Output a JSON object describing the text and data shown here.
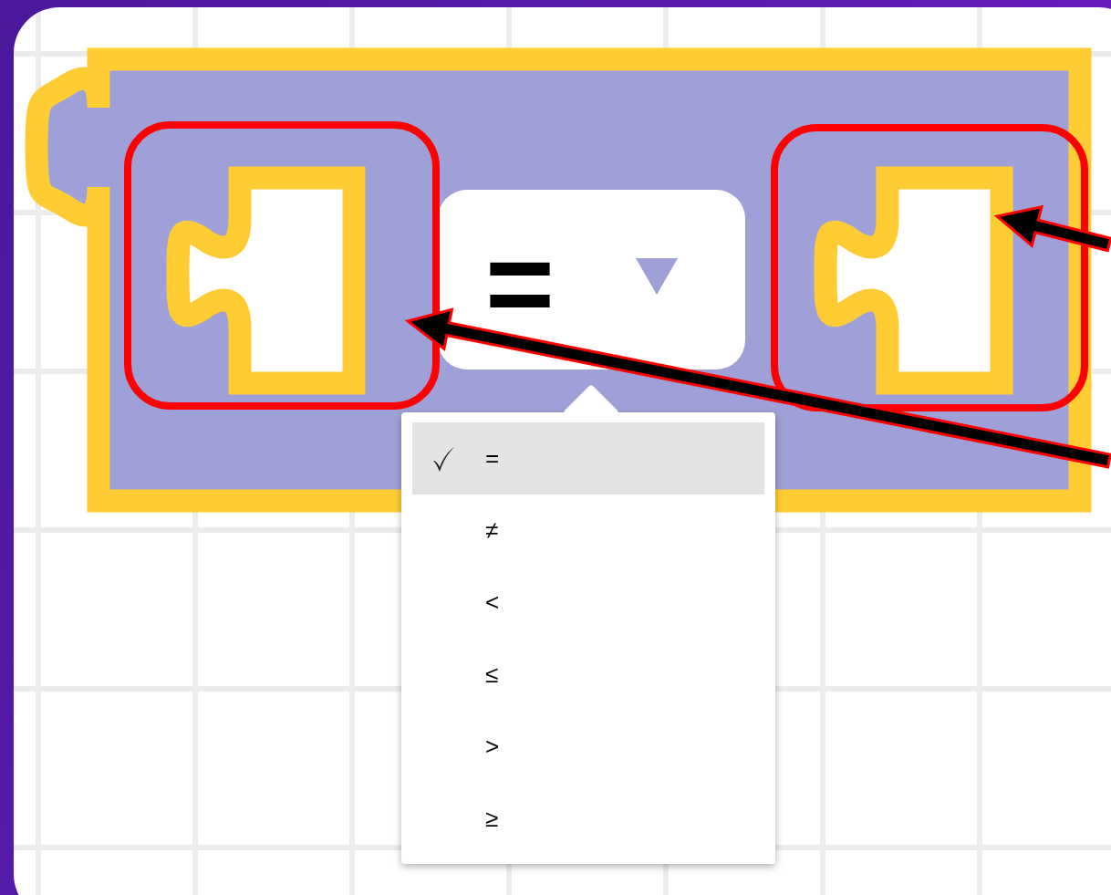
{
  "block": {
    "operator": "="
  },
  "menu": {
    "items": [
      {
        "label": "=",
        "selected": true
      },
      {
        "label": "≠",
        "selected": false
      },
      {
        "label": "<",
        "selected": false
      },
      {
        "label": "≤",
        "selected": false
      },
      {
        "label": ">",
        "selected": false
      },
      {
        "label": "≥",
        "selected": false
      }
    ]
  }
}
